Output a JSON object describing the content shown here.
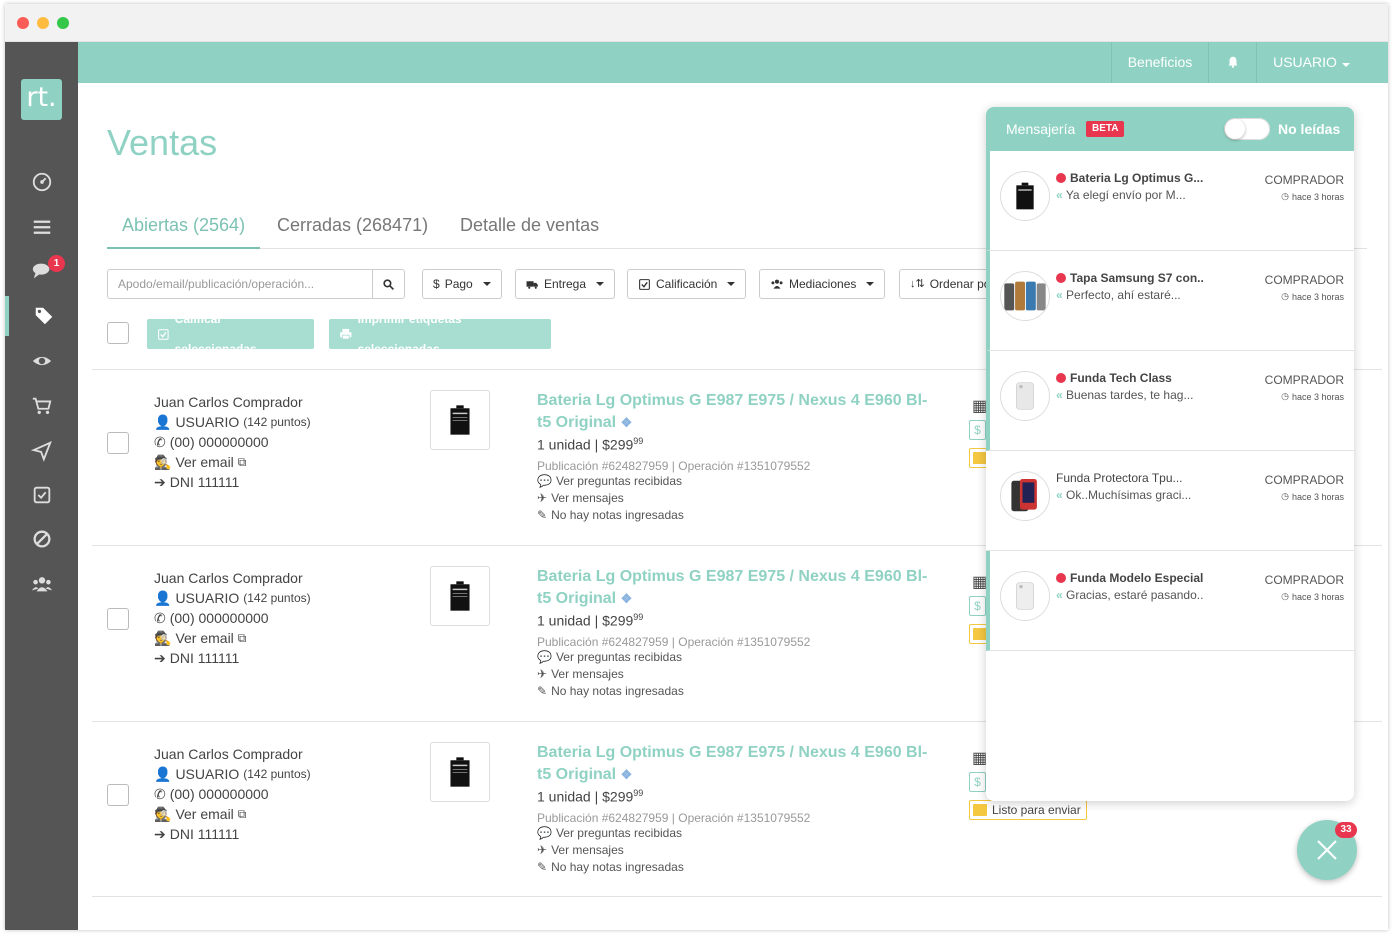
{
  "app": {
    "logo_text": "rt."
  },
  "topbar": {
    "benefits": "Beneficios",
    "user": "USUARIO"
  },
  "sidebar": {
    "messages_badge": "1"
  },
  "page": {
    "title": "Ventas"
  },
  "tabs": [
    {
      "label": "Abiertas (2564)"
    },
    {
      "label": "Cerradas (268471)"
    },
    {
      "label": "Detalle de ventas"
    }
  ],
  "filters": {
    "search_placeholder": "Apodo/email/publicación/operación...",
    "pago": "Pago",
    "entrega": "Entrega",
    "calificacion": "Calificación",
    "mediaciones": "Mediaciones",
    "ordenar": "Ordenar po"
  },
  "actions": {
    "rate": "Calificar seleccionadas",
    "print": "Imprimir etiquetas seleccionadas"
  },
  "orders": [
    {
      "buyer_name": "Juan Carlos Comprador",
      "user": "USUARIO",
      "points": "(142 puntos)",
      "phone": "(00) 000000000",
      "email_link": "Ver email",
      "dni": "DNI 111111",
      "title": "Bateria Lg Optimus G E987 E975 / Nexus 4 E960 Bl-t5 Original",
      "qty": "1 unidad | $299",
      "cents": "99",
      "publication": "Publicación #624827959 | Operación #1351079552",
      "questions": "Ver preguntas recibidas",
      "messages": "Ver mensajes",
      "notes": "No hay notas ingresadas",
      "status": ""
    },
    {
      "buyer_name": "Juan Carlos Comprador",
      "user": "USUARIO",
      "points": "(142 puntos)",
      "phone": "(00) 000000000",
      "email_link": "Ver email",
      "dni": "DNI 111111",
      "title": "Bateria Lg Optimus G E987 E975 / Nexus 4 E960 Bl-t5 Original",
      "qty": "1 unidad | $299",
      "cents": "99",
      "publication": "Publicación #624827959 | Operación #1351079552",
      "questions": "Ver preguntas recibidas",
      "messages": "Ver mensajes",
      "notes": "No hay notas ingresadas",
      "status": ""
    },
    {
      "buyer_name": "Juan Carlos Comprador",
      "user": "USUARIO",
      "points": "(142 puntos)",
      "phone": "(00) 000000000",
      "email_link": "Ver email",
      "dni": "DNI 111111",
      "title": "Bateria Lg Optimus G E987 E975 / Nexus 4 E960 Bl-t5 Original",
      "qty": "1 unidad | $299",
      "cents": "99",
      "publication": "Publicación #624827959 | Operación #1351079552",
      "questions": "Ver preguntas recibidas",
      "messages": "Ver mensajes",
      "notes": "No hay notas ingresadas",
      "status": "Listo para enviar"
    }
  ],
  "messaging": {
    "title": "Mensajería",
    "beta": "BETA",
    "unread_toggle": "No leídas",
    "conversations": [
      {
        "title": "Bateria Lg Optimus G...",
        "message": "Ya elegí envío por M...",
        "role": "COMPRADOR",
        "time": "hace 3 horas",
        "unread": true
      },
      {
        "title": "Tapa Samsung S7 con..",
        "message": "Perfecto, ahí estaré...",
        "role": "COMPRADOR",
        "time": "hace 3 horas",
        "unread": true
      },
      {
        "title": "Funda Tech Class",
        "message": "Buenas tardes, te hag...",
        "role": "COMPRADOR",
        "time": "hace 3 horas",
        "unread": true
      },
      {
        "title": "Funda Protectora Tpu...",
        "message": "Ok..Muchísimas graci...",
        "role": "COMPRADOR",
        "time": "hace 3 horas",
        "unread": false
      },
      {
        "title": "Funda Modelo Especial",
        "message": "Gracias, estaré pasando..",
        "role": "COMPRADOR",
        "time": "hace 3 horas",
        "unread": true
      }
    ]
  },
  "fab": {
    "badge": "33"
  },
  "colors": {
    "brand": "#8fd2c3",
    "sidebar": "#555555",
    "alert": "#e8364f",
    "warning": "#f5c842"
  }
}
